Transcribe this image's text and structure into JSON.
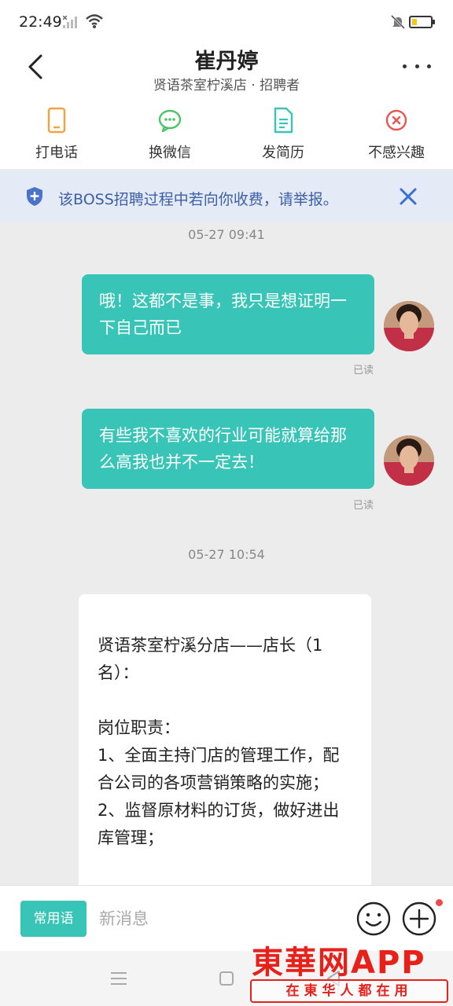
{
  "status_bar": {
    "time": "22:49",
    "icons": [
      "signal-icon",
      "wifi-icon",
      "mute-icon",
      "battery-icon"
    ],
    "battery_level": 0.2
  },
  "header": {
    "title": "崔丹婷",
    "subtitle": "贤语茶室柠溪店 · 招聘者",
    "back_icon": "chevron-left-icon",
    "more_icon": "more-icon"
  },
  "actions": [
    {
      "label": "打电话",
      "icon": "phone-icon",
      "color": "#f0a340"
    },
    {
      "label": "换微信",
      "icon": "wechat-icon",
      "color": "#4cc36a"
    },
    {
      "label": "发简历",
      "icon": "resume-icon",
      "color": "#38c4b6"
    },
    {
      "label": "不感兴趣",
      "icon": "not-interested-icon",
      "color": "#e85555"
    }
  ],
  "notice": {
    "text": "该BOSS招聘过程中若向你收费，请举报。",
    "icon": "shield-icon",
    "close_icon": "close-icon"
  },
  "chat": {
    "timestamps": [
      "05-27 09:41",
      "05-27 10:54"
    ],
    "messages": [
      {
        "text": "哦！这都不是事，我只是想证明一下自己而已",
        "status": "已读"
      },
      {
        "text": "有些我不喜欢的行业可能就算给那么高我也并不一定去！",
        "status": "已读"
      }
    ],
    "card_lines": [
      "贤语茶室柠溪分店——店长（1名）：",
      "",
      "岗位职责：",
      "1、全面主持门店的管理工作，配合公司的各项营销策略的实施；",
      "2、监督原材料的订货，做好进出库管理；"
    ]
  },
  "input_bar": {
    "phrases_label": "常用语",
    "placeholder": "新消息",
    "emoji_icon": "emoji-icon",
    "plus_icon": "plus-icon"
  },
  "nav": {
    "icons": [
      "menu-icon",
      "home-icon",
      "back-icon"
    ]
  },
  "watermark": {
    "name": "東華网APP",
    "slogan": "在東华人都在用"
  },
  "colors": {
    "accent": "#38c4b6",
    "notice_bg": "#e4eaf6",
    "notice_text": "#3d5fa8",
    "watermark": "#e8201a"
  }
}
